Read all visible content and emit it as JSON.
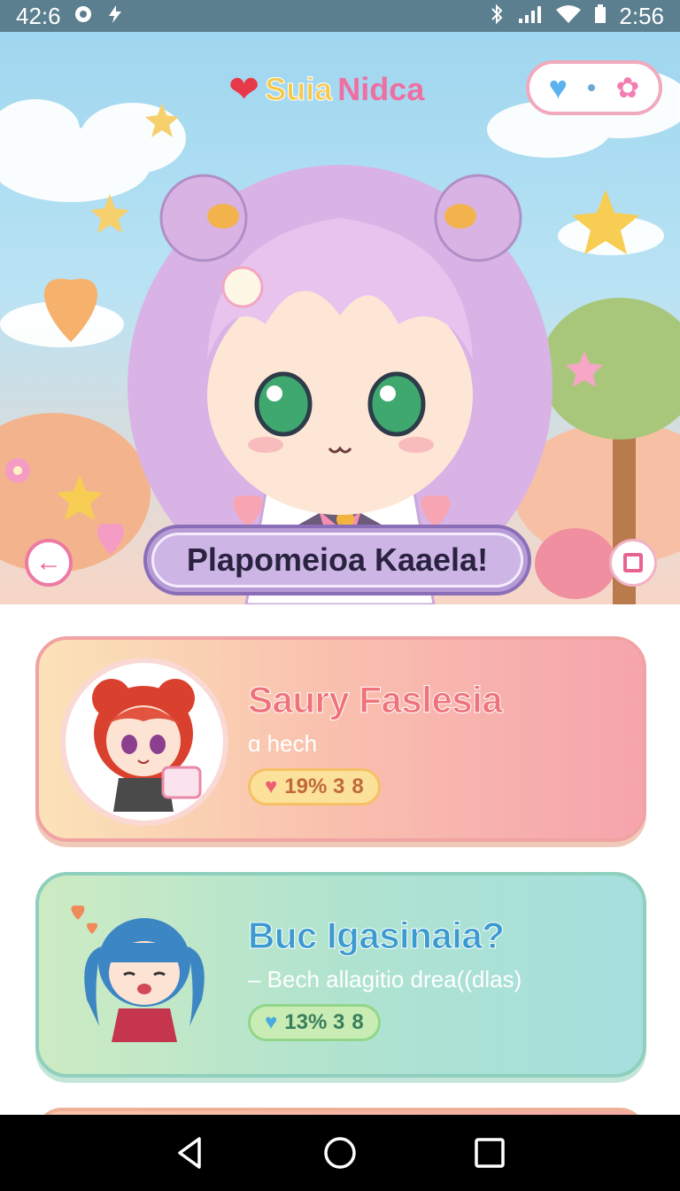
{
  "status_bar": {
    "time_left": "42:6",
    "time_right": "2:56",
    "icons_left": [
      "settings-dot-icon",
      "flash-icon"
    ],
    "icons_right": [
      "bluetooth-icon",
      "signal-icon",
      "wifi-icon",
      "battery-icon"
    ]
  },
  "header": {
    "title_part1": "Suia",
    "title_part2": "Nidca",
    "heart_glyph": "❤",
    "pill_heart": "♥",
    "pill_flower": "✿"
  },
  "hero": {
    "character_name": "Plapomeioa Kaaela!",
    "back_glyph": "←"
  },
  "cards": [
    {
      "name": "Saury Faslesia",
      "subtitle": "ɑ hech",
      "badge_heart": "♥",
      "badge_value": "19% 3",
      "badge_extra": "8"
    },
    {
      "name": "Buc Igasinaia?",
      "subtitle": "– Bech allagitio drea((dlas)",
      "badge_heart": "♥",
      "badge_value": "13% 3",
      "badge_extra": "8"
    }
  ],
  "colors": {
    "status_bar": "#5b7f8f",
    "card1_accent": "#f0737b",
    "card2_accent": "#3b9ad0",
    "nav_bar": "#000000"
  }
}
